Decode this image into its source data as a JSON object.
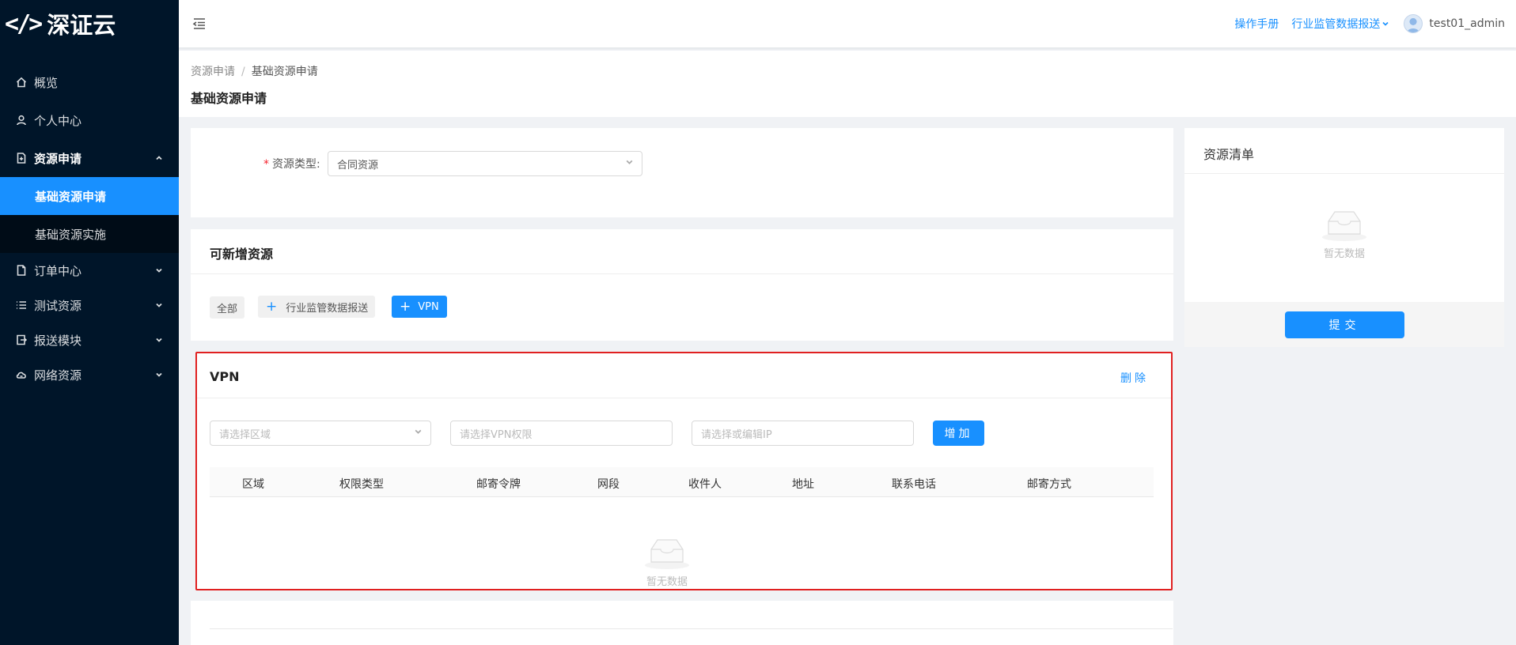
{
  "brand": {
    "mark": "</>",
    "name": "深证云"
  },
  "sidebar": {
    "items": [
      {
        "label": "概览",
        "icon": "home-icon"
      },
      {
        "label": "个人中心",
        "icon": "user-icon"
      },
      {
        "label": "资源申请",
        "icon": "file-plus-icon",
        "expanded": true,
        "children": [
          {
            "label": "基础资源申请",
            "active": true
          },
          {
            "label": "基础资源实施"
          }
        ]
      },
      {
        "label": "订单中心",
        "icon": "file-icon"
      },
      {
        "label": "测试资源",
        "icon": "list-icon"
      },
      {
        "label": "报送模块",
        "icon": "export-icon"
      },
      {
        "label": "网络资源",
        "icon": "cloud-icon"
      }
    ]
  },
  "header": {
    "manual_link": "操作手册",
    "supervision_menu": "行业监管数据报送",
    "username": "test01_admin"
  },
  "breadcrumb": {
    "parent": "资源申请",
    "separator": "/",
    "current": "基础资源申请"
  },
  "page_title": "基础资源申请",
  "form": {
    "resource_type_label": "资源类型:",
    "resource_type_value": "合同资源"
  },
  "available": {
    "title": "可新增资源",
    "tags": {
      "all": "全部",
      "industry": "行业监管数据报送",
      "vpn": "VPN"
    }
  },
  "vpn": {
    "title": "VPN",
    "delete_label": "删除",
    "region_placeholder": "请选择区域",
    "permission_placeholder": "请选择VPN权限",
    "ip_placeholder": "请选择或编辑IP",
    "add_label": "增加",
    "columns": [
      "区域",
      "权限类型",
      "邮寄令牌",
      "网段",
      "收件人",
      "地址",
      "联系电话",
      "邮寄方式"
    ],
    "empty_text": "暂无数据"
  },
  "resource_list": {
    "title": "资源清单",
    "empty_text": "暂无数据",
    "submit_label": "提交"
  },
  "colors": {
    "primary": "#1890ff",
    "sidebar_bg": "#001529",
    "highlight_border": "#e02020"
  }
}
